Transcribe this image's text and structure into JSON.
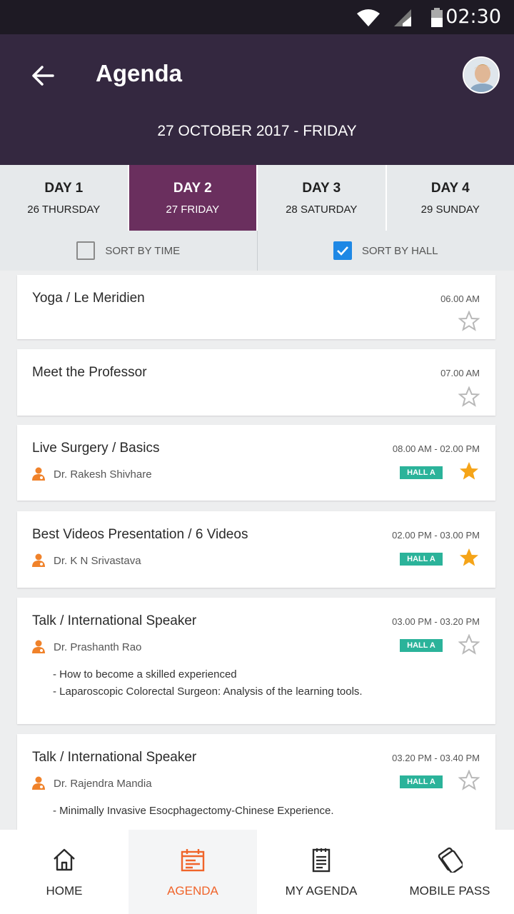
{
  "status": {
    "time": "02:30"
  },
  "header": {
    "title": "Agenda",
    "date": "27 OCTOBER 2017 - FRIDAY"
  },
  "days": [
    {
      "title": "DAY 1",
      "sub": "26 THURSDAY"
    },
    {
      "title": "DAY 2",
      "sub": "27 FRIDAY"
    },
    {
      "title": "DAY 3",
      "sub": "28 SATURDAY"
    },
    {
      "title": "DAY 4",
      "sub": "29 SUNDAY"
    }
  ],
  "active_day": "DAY 2",
  "sort": {
    "time_label": "SORT BY TIME",
    "hall_label": "SORT BY HALL",
    "selected": "SORT BY HALL"
  },
  "sessions": [
    {
      "title": "Yoga / Le Meridien",
      "time": "06.00 AM",
      "starred": false
    },
    {
      "title": "Meet the Professor",
      "time": "07.00 AM",
      "starred": false
    },
    {
      "title": "Live Surgery / Basics",
      "time": "08.00 AM - 02.00 PM",
      "speaker": "Dr. Rakesh Shivhare",
      "hall": "HALL A",
      "starred": true
    },
    {
      "title": "Best Videos Presentation / 6 Videos",
      "time": "02.00 PM - 03.00 PM",
      "speaker": "Dr. K N Srivastava",
      "hall": "HALL A",
      "starred": true
    },
    {
      "title": "Talk / International Speaker",
      "time": "03.00 PM - 03.20 PM",
      "speaker": "Dr. Prashanth Rao",
      "hall": "HALL A",
      "starred": false,
      "topics": [
        "- How to become a skilled experienced",
        "- Laparoscopic Colorectal Surgeon: Analysis of the learning tools."
      ]
    },
    {
      "title": "Talk / International Speaker",
      "time": "03.20 PM - 03.40 PM",
      "speaker": "Dr. Rajendra Mandia",
      "hall": "HALL A",
      "starred": false,
      "topics": [
        "- Minimally Invasive Esocphagectomy-Chinese Experience."
      ]
    }
  ],
  "nav": [
    {
      "label": "HOME",
      "icon": "home-icon"
    },
    {
      "label": "AGENDA",
      "icon": "agenda-icon"
    },
    {
      "label": "MY AGENDA",
      "icon": "my-agenda-icon"
    },
    {
      "label": "MOBILE PASS",
      "icon": "mobile-pass-icon"
    }
  ],
  "active_nav": "AGENDA",
  "colors": {
    "header": "#342840",
    "active_day": "#6a2f5e",
    "hall_badge": "#2bb39a",
    "star": "#f5a418",
    "accent": "#f0642a",
    "checkbox": "#1e88e5"
  }
}
